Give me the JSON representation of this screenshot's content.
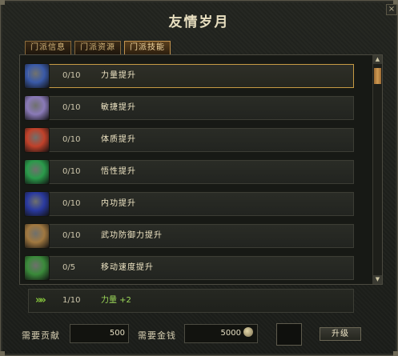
{
  "window": {
    "title": "友情岁月",
    "close_label": "×"
  },
  "tabs": [
    {
      "label": "门派信息",
      "active": false
    },
    {
      "label": "门派资源",
      "active": false
    },
    {
      "label": "门派技能",
      "active": true
    }
  ],
  "skills": [
    {
      "level": "0/10",
      "name": "力量提升",
      "icon": "strength-icon",
      "color": "#3a5aa8",
      "selected": true
    },
    {
      "level": "0/10",
      "name": "敏捷提升",
      "icon": "agility-icon",
      "color": "#8a7ab8",
      "selected": false
    },
    {
      "level": "0/10",
      "name": "体质提升",
      "icon": "constitution-icon",
      "color": "#c0412a",
      "selected": false
    },
    {
      "level": "0/10",
      "name": "悟性提升",
      "icon": "comprehension-icon",
      "color": "#2a9a4a",
      "selected": false
    },
    {
      "level": "0/10",
      "name": "内功提升",
      "icon": "inner-power-icon",
      "color": "#2a3aa0",
      "selected": false
    },
    {
      "level": "0/10",
      "name": "武功防御力提升",
      "icon": "martial-defense-icon",
      "color": "#a07840",
      "selected": false
    },
    {
      "level": "0/5",
      "name": "移动速度提升",
      "icon": "movement-speed-icon",
      "color": "#3a8a3a",
      "selected": false
    }
  ],
  "next_level": {
    "level": "1/10",
    "attribute": "力量 +2",
    "icon": "double-arrow-icon"
  },
  "footer": {
    "contribution_label": "需要贡献",
    "contribution_value": "500",
    "gold_label": "需要金钱",
    "gold_value": "5000",
    "upgrade_label": "升级"
  },
  "scrollbar": {
    "up": "▲",
    "down": "▼"
  }
}
